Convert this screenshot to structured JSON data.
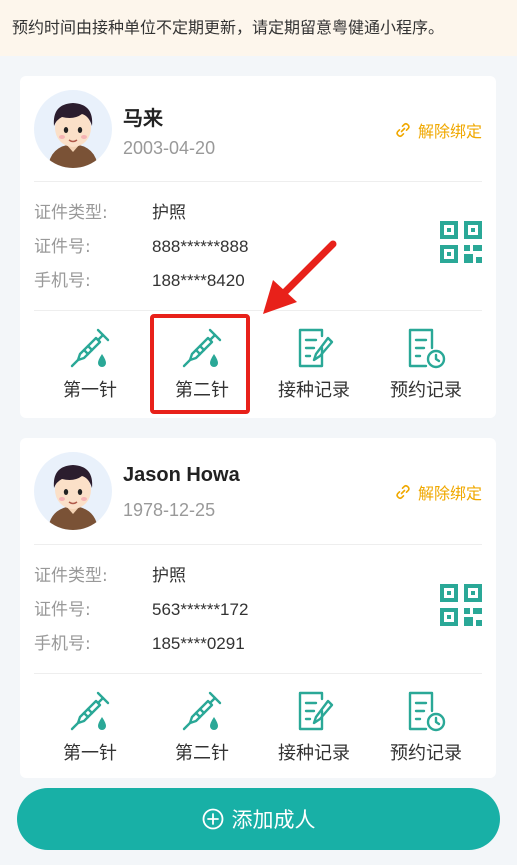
{
  "notice": "预约时间由接种单位不定期更新，请定期留意粤健通小程序。",
  "persons": [
    {
      "name": "马来",
      "dob": "2003-04-20",
      "unbind_label": "解除绑定",
      "id_type_label": "证件类型:",
      "id_type": "护照",
      "id_no_label": "证件号:",
      "id_no": "888******888",
      "phone_label": "手机号:",
      "phone": "188****8420",
      "actions": [
        "第一针",
        "第二针",
        "接种记录",
        "预约记录"
      ]
    },
    {
      "name": "Jason Howa",
      "dob": "1978-12-25",
      "unbind_label": "解除绑定",
      "id_type_label": "证件类型:",
      "id_type": "护照",
      "id_no_label": "证件号:",
      "id_no": "563******172",
      "phone_label": "手机号:",
      "phone": "185****0291",
      "actions": [
        "第一针",
        "第二针",
        "接种记录",
        "预约记录"
      ]
    }
  ],
  "add_button": "添加成人",
  "colors": {
    "accent": "#18b0a6",
    "icon": "#2aa897",
    "warning": "#f0a800",
    "highlight": "#e8211a"
  },
  "icons": [
    "syringe-icon",
    "document-edit-icon",
    "document-clock-icon",
    "qr-code-icon",
    "link-icon",
    "plus-circle-icon"
  ]
}
